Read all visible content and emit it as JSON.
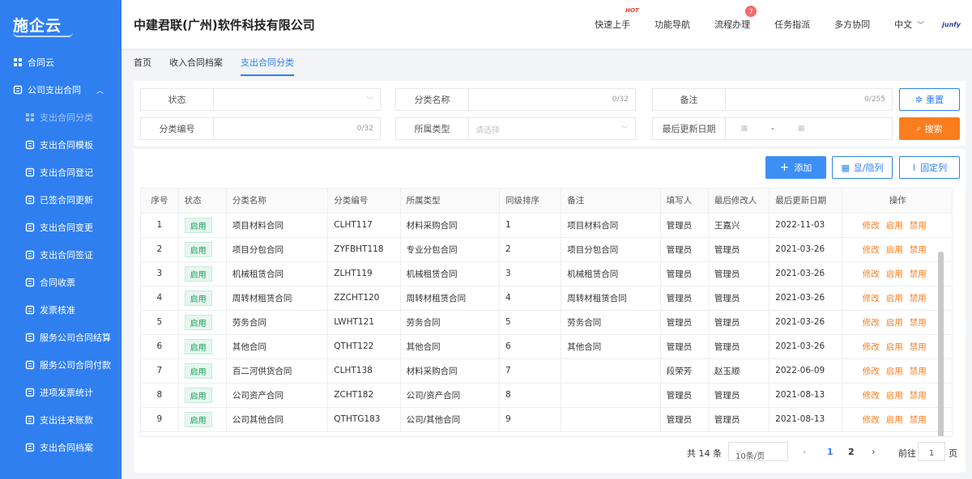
{
  "logo": "施企云",
  "company": "中建君联(广州)软件科技有限公司",
  "topnav": [
    {
      "label": "快速上手",
      "tag": "HOT"
    },
    {
      "label": "功能导航"
    },
    {
      "label": "流程办理",
      "badge": "7"
    },
    {
      "label": "任务指派"
    },
    {
      "label": "多方协同"
    }
  ],
  "lang": "中文",
  "brand": "junfy",
  "sidebar": [
    {
      "label": "合同云",
      "icon": "grid-icon",
      "level": 0
    },
    {
      "label": "公司支出合同",
      "icon": "document-icon",
      "level": 0,
      "expanded": true
    },
    {
      "label": "支出合同分类",
      "icon": "grid-icon",
      "level": 1,
      "active": true
    },
    {
      "label": "支出合同模板",
      "icon": "org-icon",
      "level": 1
    },
    {
      "label": "支出合同登记",
      "icon": "register-icon",
      "level": 1
    },
    {
      "label": "已签合同更新",
      "icon": "edit-icon",
      "level": 1
    },
    {
      "label": "支出合同变更",
      "icon": "swap-icon",
      "level": 1
    },
    {
      "label": "支出合同签证",
      "icon": "save-icon",
      "level": 1
    },
    {
      "label": "合同收票",
      "icon": "receipt-icon",
      "level": 1
    },
    {
      "label": "发票核准",
      "icon": "stamp-icon",
      "level": 1
    },
    {
      "label": "服务公司合同结算",
      "icon": "settle-icon",
      "level": 1
    },
    {
      "label": "服务公司合同付款",
      "icon": "yuan-icon",
      "level": 1
    },
    {
      "label": "进项发票统计",
      "icon": "stats-icon",
      "level": 1
    },
    {
      "label": "支出往来账款",
      "icon": "calendar-icon",
      "level": 1
    },
    {
      "label": "支出合同档案",
      "icon": "archive-icon",
      "level": 1
    }
  ],
  "tabs": [
    "首页",
    "收入合同档案",
    "支出合同分类"
  ],
  "filters": {
    "status_label": "状态",
    "name_label": "分类名称",
    "name_count": "0/32",
    "remark_label": "备注",
    "remark_count": "0/255",
    "code_label": "分类编号",
    "code_count": "0/32",
    "type_label": "所属类型",
    "type_placeholder": "请选择",
    "date_label": "最后更新日期",
    "date_sep": "-",
    "reset": "重置",
    "search": "搜索"
  },
  "toolbar": {
    "add": "添加",
    "toggle_cols": "显/隐列",
    "fixed_cols": "固定列"
  },
  "table": {
    "headers": [
      "序号",
      "状态",
      "分类名称",
      "分类编号",
      "所属类型",
      "同级排序",
      "备注",
      "填写人",
      "最后修改人",
      "最后更新日期",
      "操作"
    ],
    "actions": [
      "修改",
      "启用",
      "禁用"
    ],
    "rows": [
      [
        "1",
        "启用",
        "项目材料合同",
        "CLHT117",
        "材料采购合同",
        "1",
        "项目材料合同",
        "管理员",
        "王嘉兴",
        "2022-11-03"
      ],
      [
        "2",
        "启用",
        "项目分包合同",
        "ZYFBHT118",
        "专业分包合同",
        "2",
        "项目分包合同",
        "管理员",
        "管理员",
        "2021-03-26"
      ],
      [
        "3",
        "启用",
        "机械租赁合同",
        "ZLHT119",
        "机械租赁合同",
        "3",
        "机械租赁合同",
        "管理员",
        "管理员",
        "2021-03-26"
      ],
      [
        "4",
        "启用",
        "周转材租赁合同",
        "ZZCHT120",
        "周转材租赁合同",
        "4",
        "周转材租赁合同",
        "管理员",
        "管理员",
        "2021-03-26"
      ],
      [
        "5",
        "启用",
        "劳务合同",
        "LWHT121",
        "劳务合同",
        "5",
        "劳务合同",
        "管理员",
        "管理员",
        "2021-03-26"
      ],
      [
        "6",
        "启用",
        "其他合同",
        "QTHT122",
        "其他合同",
        "6",
        "其他合同",
        "管理员",
        "管理员",
        "2021-03-26"
      ],
      [
        "7",
        "启用",
        "百二河供货合同",
        "CLHT138",
        "材料采购合同",
        "7",
        "",
        "段荣芳",
        "赵玉顺",
        "2022-06-09"
      ],
      [
        "8",
        "启用",
        "公司资产合同",
        "ZCHT182",
        "公司/资产合同",
        "8",
        "",
        "管理员",
        "管理员",
        "2021-08-13"
      ],
      [
        "9",
        "启用",
        "公司其他合同",
        "QTHTG183",
        "公司/其他合同",
        "9",
        "",
        "管理员",
        "管理员",
        "2021-08-13"
      ]
    ]
  },
  "pager": {
    "total": "共 14 条",
    "size": "10条/页",
    "pages": [
      "1",
      "2"
    ],
    "current": "1",
    "goto": "前往",
    "goto_value": "1",
    "page_unit": "页"
  }
}
